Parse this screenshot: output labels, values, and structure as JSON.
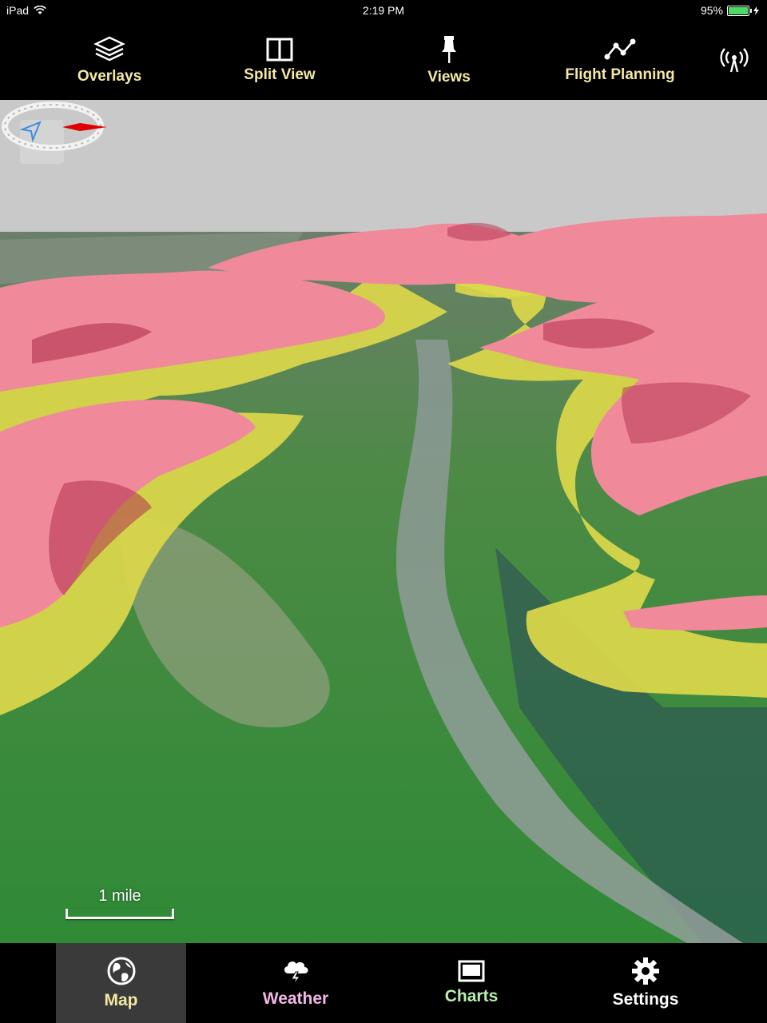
{
  "status_bar": {
    "device": "iPad",
    "time": "2:19 PM",
    "battery": "95%",
    "battery_level": 0.95
  },
  "toolbar": {
    "overlays_label": "Overlays",
    "split_view_label": "Split View",
    "views_label": "Views",
    "flight_planning_label": "Flight Planning",
    "icons": {
      "overlays": "layers-icon",
      "split_view": "split-view-icon",
      "views": "pushpin-icon",
      "flight_planning": "route-icon",
      "connection": "antenna-icon"
    }
  },
  "map": {
    "scale_label": "1 mile",
    "colors": {
      "sky": "#c9c9c9",
      "danger_terrain": "#f08a9a",
      "caution_terrain": "#e0dc4a",
      "valley": "#3f8a3a",
      "compass_marker": "#e00000"
    }
  },
  "tabbar": {
    "map_label": "Map",
    "weather_label": "Weather",
    "charts_label": "Charts",
    "settings_label": "Settings",
    "selected": "Map",
    "colors": {
      "map": "#f3e9a2",
      "weather": "#f2b8e6",
      "charts": "#b8f0b0",
      "settings": "#ffffff"
    }
  }
}
